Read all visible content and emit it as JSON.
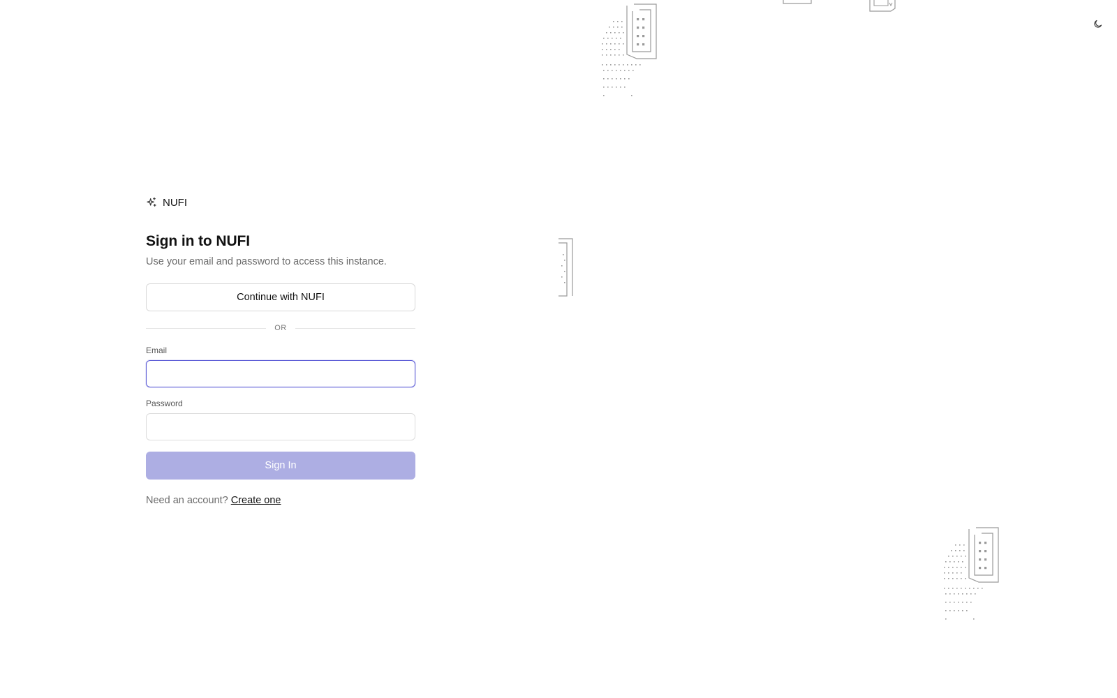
{
  "header": {
    "theme_toggle_icon": "moon-icon"
  },
  "brand": {
    "icon": "sparkles-icon",
    "name": "NUFI"
  },
  "login": {
    "title": "Sign in to NUFI",
    "subtitle": "Use your email and password to access this instance.",
    "sso_button_label": "Continue with NUFI",
    "divider_text": "OR",
    "email": {
      "label": "Email",
      "value": "",
      "placeholder": ""
    },
    "password": {
      "label": "Password",
      "value": "",
      "placeholder": ""
    },
    "submit_label": "Sign In",
    "footer_prompt": "Need an account?",
    "footer_link": "Create one"
  },
  "colors": {
    "accent": "#5b5bd6",
    "submit_disabled_bg": "#adaee3",
    "muted_text": "#6b6b6b",
    "border": "#d9d9d9",
    "decoration": "#9a9a9a"
  }
}
